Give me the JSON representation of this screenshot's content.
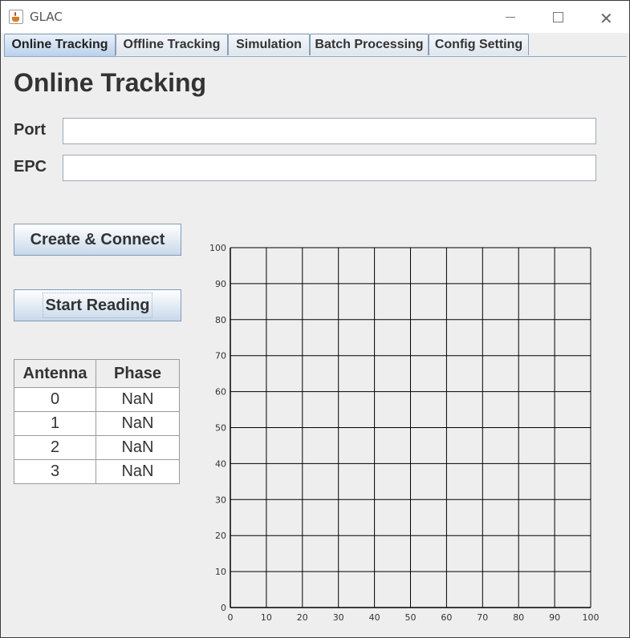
{
  "window": {
    "title": "GLAC"
  },
  "tabs": [
    "Online Tracking",
    "Offline Tracking",
    "Simulation",
    "Batch Processing",
    "Config Setting"
  ],
  "page": {
    "title": "Online Tracking"
  },
  "form": {
    "port_label": "Port",
    "port_value": "",
    "epc_label": "EPC",
    "epc_value": ""
  },
  "buttons": {
    "create_connect": "Create & Connect",
    "start_reading": "Start Reading"
  },
  "table": {
    "headers": [
      "Antenna",
      "Phase"
    ],
    "rows": [
      [
        "0",
        "NaN"
      ],
      [
        "1",
        "NaN"
      ],
      [
        "2",
        "NaN"
      ],
      [
        "3",
        "NaN"
      ]
    ]
  },
  "icons": {
    "app": "java-cup-icon",
    "minimize": "minimize-icon",
    "maximize": "maximize-icon",
    "close": "close-icon"
  },
  "chart_data": {
    "type": "scatter",
    "title": "",
    "xlabel": "",
    "ylabel": "",
    "xlim": [
      0,
      100
    ],
    "ylim": [
      0,
      100
    ],
    "xticks": [
      0,
      10,
      20,
      30,
      40,
      50,
      60,
      70,
      80,
      90,
      100
    ],
    "yticks": [
      0,
      10,
      20,
      30,
      40,
      50,
      60,
      70,
      80,
      90,
      100
    ],
    "grid": true,
    "series": []
  }
}
